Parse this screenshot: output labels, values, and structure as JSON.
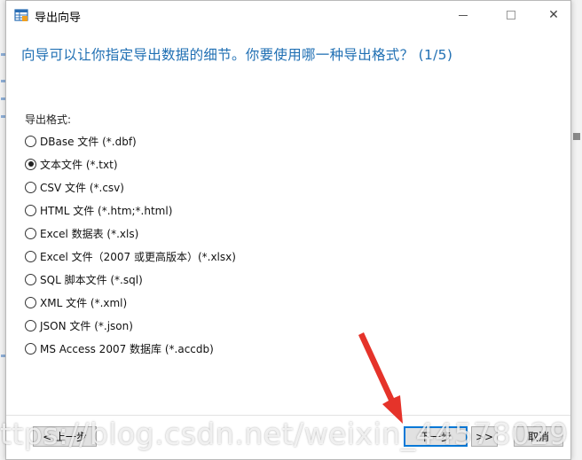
{
  "window": {
    "title": "导出向导",
    "minimize_icon": "minimize-icon",
    "maximize_icon": "maximize-icon",
    "close_icon": "close-icon",
    "close_glyph": "✕"
  },
  "heading": "向导可以让你指定导出数据的细节。你要使用哪一种导出格式？ (1/5)",
  "group_label": "导出格式:",
  "options": [
    {
      "label": "DBase 文件 (*.dbf)",
      "checked": false
    },
    {
      "label": "文本文件 (*.txt)",
      "checked": true
    },
    {
      "label": "CSV 文件 (*.csv)",
      "checked": false
    },
    {
      "label": "HTML 文件 (*.htm;*.html)",
      "checked": false
    },
    {
      "label": "Excel 数据表 (*.xls)",
      "checked": false
    },
    {
      "label": "Excel 文件（2007 或更高版本）(*.xlsx)",
      "checked": false
    },
    {
      "label": "SQL 脚本文件 (*.sql)",
      "checked": false
    },
    {
      "label": "XML 文件 (*.xml)",
      "checked": false
    },
    {
      "label": "JSON 文件 (*.json)",
      "checked": false
    },
    {
      "label": "MS Access 2007 数据库 (*.accdb)",
      "checked": false
    }
  ],
  "buttons": {
    "prev": "< 上一步",
    "next": "下一步",
    "finish": ">>",
    "cancel": "取消"
  },
  "watermark": "ttps://blog.csdn.net/weixin_44578029",
  "colors": {
    "heading": "#1f6fb3",
    "arrow": "#e5332a",
    "focus": "#0078d7"
  }
}
